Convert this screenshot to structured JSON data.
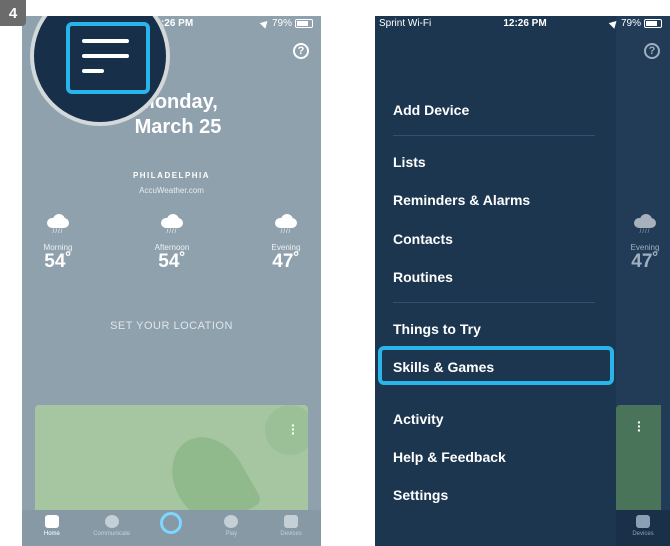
{
  "step_number": "4",
  "left_phone": {
    "status": {
      "time": "12:26 PM",
      "battery": "79%"
    },
    "help_glyph": "?",
    "date_line1": "Monday,",
    "date_line2": "March 25",
    "city": "PHILADELPHIA",
    "source": "AccuWeather.com",
    "weather": [
      {
        "label": "Morning",
        "temp": "54˚",
        "icon": "rain-cloud-icon"
      },
      {
        "label": "Afternoon",
        "temp": "54˚",
        "icon": "rain-cloud-icon"
      },
      {
        "label": "Evening",
        "temp": "47˚",
        "icon": "rain-cloud-icon"
      }
    ],
    "set_location": "SET YOUR LOCATION",
    "nav": [
      {
        "label": "Home",
        "icon": "home-icon"
      },
      {
        "label": "Communicate",
        "icon": "chat-bubble-icon"
      },
      {
        "label": "",
        "icon": "alexa-ring-icon"
      },
      {
        "label": "Play",
        "icon": "play-icon"
      },
      {
        "label": "Devices",
        "icon": "devices-icon"
      }
    ]
  },
  "right_phone": {
    "status": {
      "carrier": "Sprint Wi-Fi",
      "time": "12:26 PM",
      "battery": "79%"
    },
    "help_glyph": "?",
    "menu": {
      "add_device": "Add Device",
      "lists": "Lists",
      "reminders": "Reminders & Alarms",
      "contacts": "Contacts",
      "routines": "Routines",
      "things_to_try": "Things to Try",
      "skills_games": "Skills & Games",
      "activity": "Activity",
      "help_feedback": "Help & Feedback",
      "settings": "Settings"
    },
    "peek_weather": {
      "label": "Evening",
      "temp": "47˚"
    },
    "peek_nav_label": "Devices"
  },
  "colors": {
    "highlight": "#2ab5ea",
    "drawer_bg": "#1d3650",
    "home_bg": "#8fa1ad"
  }
}
